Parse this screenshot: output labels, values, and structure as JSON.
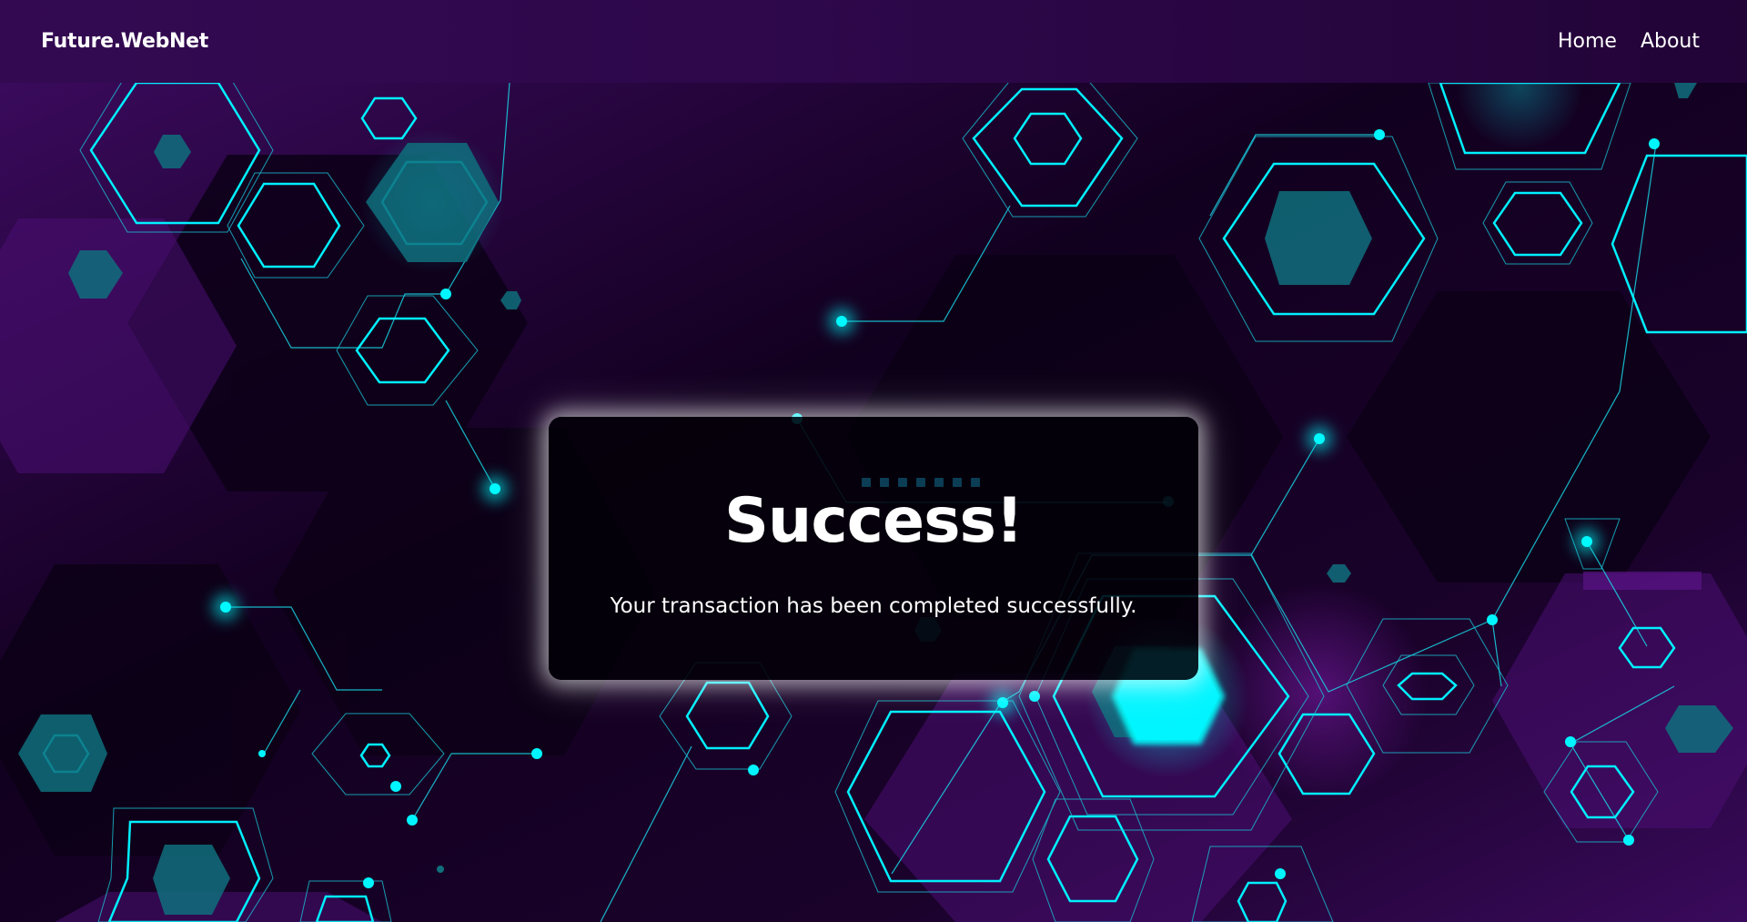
{
  "navbar": {
    "brand": "Future.WebNet",
    "links": [
      {
        "label": "Home"
      },
      {
        "label": "About"
      }
    ]
  },
  "card": {
    "title": "Success!",
    "message": "Your transaction has been completed successfully."
  },
  "colors": {
    "accent": "#00f0ff",
    "navbar": "#2c0748",
    "background": "#12001f",
    "card": "#030008"
  },
  "icons": [
    "hexagon-network-background",
    "loading-dots"
  ]
}
